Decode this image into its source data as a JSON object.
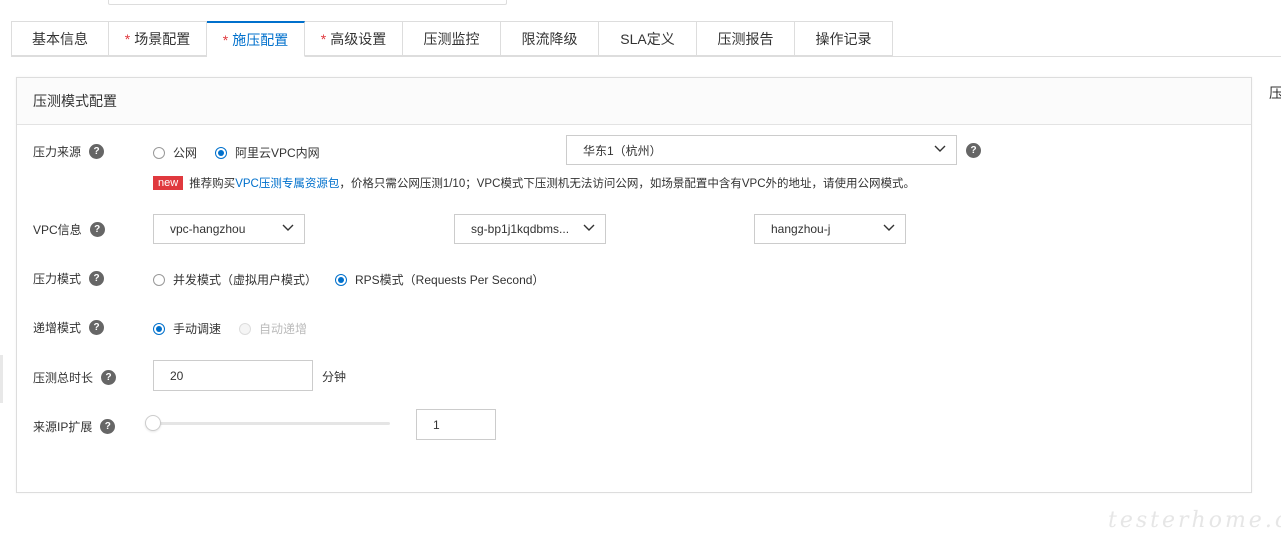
{
  "tabs": [
    {
      "label": "基本信息",
      "required": false
    },
    {
      "label": "场景配置",
      "required": true
    },
    {
      "label": "施压配置",
      "required": true,
      "active": true
    },
    {
      "label": "高级设置",
      "required": true
    },
    {
      "label": "压测监控",
      "required": false
    },
    {
      "label": "限流降级",
      "required": false
    },
    {
      "label": "SLA定义",
      "required": false
    },
    {
      "label": "压测报告",
      "required": false
    },
    {
      "label": "操作记录",
      "required": false
    }
  ],
  "required_mark": "*",
  "panel": {
    "title": "压测模式配置"
  },
  "right_edge_text": "压",
  "help_glyph": "?",
  "pressure_source": {
    "label": "压力来源",
    "option_public": "公网",
    "option_vpc": "阿里云VPC内网",
    "selected": "阿里云VPC内网",
    "region": "华东1（杭州）",
    "note": {
      "badge": "new",
      "prefix": "推荐购买",
      "link": "VPC压测专属资源包",
      "suffix": "，价格只需公网压测1/10；VPC模式下压测机无法访问公网，如场景配置中含有VPC外的地址，请使用公网模式。"
    }
  },
  "vpc_info": {
    "label": "VPC信息",
    "vpc": "vpc-hangzhou",
    "security_group": "sg-bp1j1kqdbms...",
    "vswitch": "hangzhou-j"
  },
  "pressure_mode": {
    "label": "压力模式",
    "option_concurrency": "并发模式（虚拟用户模式）",
    "option_rps": "RPS模式（Requests Per Second）",
    "selected": "RPS模式（Requests Per Second）"
  },
  "ramp_mode": {
    "label": "递增模式",
    "option_manual": "手动调速",
    "option_auto": "自动递增",
    "selected": "手动调速"
  },
  "duration": {
    "label": "压测总时长",
    "value": "20",
    "unit": "分钟"
  },
  "ip_expansion": {
    "label": "来源IP扩展",
    "value": "1",
    "slider_fraction": 0
  },
  "watermark": "testerhome.com",
  "colors": {
    "accent": "#0070cc",
    "required": "#e0393e",
    "badge": "#e0393e"
  }
}
